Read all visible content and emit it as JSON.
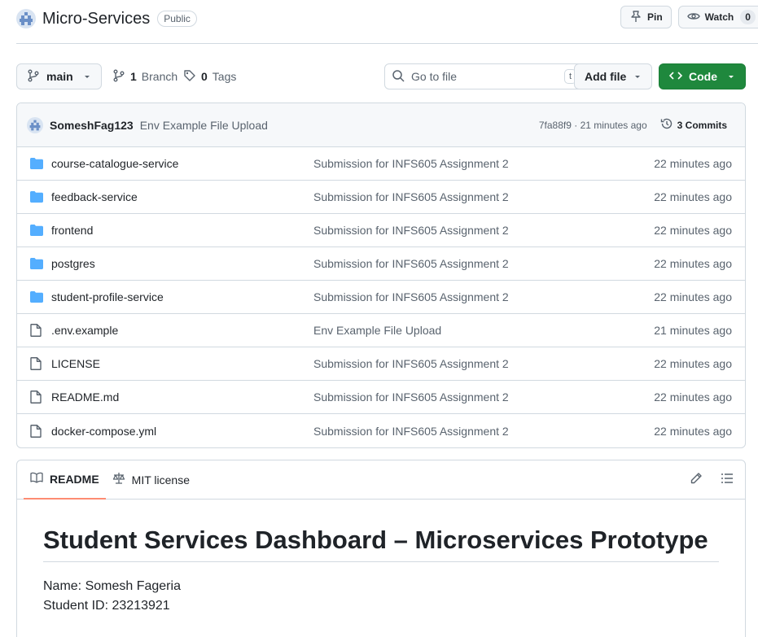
{
  "repo": {
    "name": "Micro-Services",
    "visibility": "Public"
  },
  "header_actions": {
    "pin": "Pin",
    "watch": "Watch",
    "watch_count": "0"
  },
  "toolbar": {
    "branch": "main",
    "branch_count": "1",
    "branch_label": "Branch",
    "tag_count": "0",
    "tag_label": "Tags",
    "goto_placeholder": "Go to file",
    "goto_shortcut": "t",
    "add_file": "Add file",
    "code": "Code"
  },
  "latest_commit": {
    "author": "SomeshFag123",
    "message": "Env Example File Upload",
    "hash_time": "7fa88f9 · 21 minutes ago",
    "commits": "3 Commits"
  },
  "files": [
    {
      "name": "course-catalogue-service",
      "type": "folder",
      "commit": "Submission for INFS605 Assignment 2",
      "age": "22 minutes ago"
    },
    {
      "name": "feedback-service",
      "type": "folder",
      "commit": "Submission for INFS605 Assignment 2",
      "age": "22 minutes ago"
    },
    {
      "name": "frontend",
      "type": "folder",
      "commit": "Submission for INFS605 Assignment 2",
      "age": "22 minutes ago"
    },
    {
      "name": "postgres",
      "type": "folder",
      "commit": "Submission for INFS605 Assignment 2",
      "age": "22 minutes ago"
    },
    {
      "name": "student-profile-service",
      "type": "folder",
      "commit": "Submission for INFS605 Assignment 2",
      "age": "22 minutes ago"
    },
    {
      "name": ".env.example",
      "type": "file",
      "commit": "Env Example File Upload",
      "age": "21 minutes ago"
    },
    {
      "name": "LICENSE",
      "type": "file",
      "commit": "Submission for INFS605 Assignment 2",
      "age": "22 minutes ago"
    },
    {
      "name": "README.md",
      "type": "file",
      "commit": "Submission for INFS605 Assignment 2",
      "age": "22 minutes ago"
    },
    {
      "name": "docker-compose.yml",
      "type": "file",
      "commit": "Submission for INFS605 Assignment 2",
      "age": "22 minutes ago"
    }
  ],
  "readme": {
    "tab_readme": "README",
    "tab_license": "MIT license",
    "title": "Student Services Dashboard – Microservices Prototype",
    "line1": "Name: Somesh Fageria",
    "line2": "Student ID: 23213921"
  },
  "colors": {
    "accent_green": "#1f883d",
    "folder_blue": "#54aeff",
    "tab_underline": "#fd8c73"
  }
}
